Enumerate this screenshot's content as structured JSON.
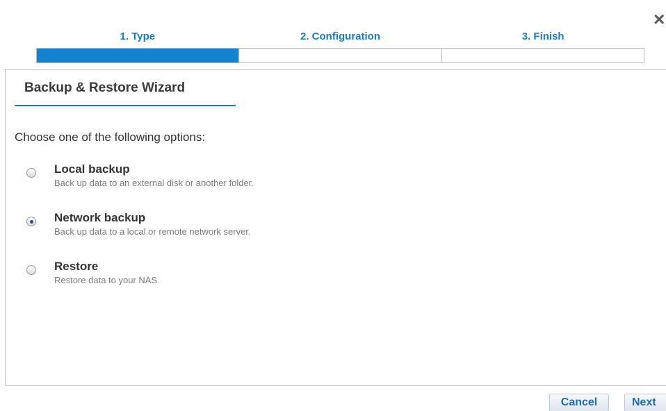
{
  "wizard": {
    "close_glyph": "×",
    "steps": [
      {
        "label": "1. Type",
        "active": true
      },
      {
        "label": "2. Configuration",
        "active": false
      },
      {
        "label": "3. Finish",
        "active": false
      }
    ],
    "title": "Backup & Restore Wizard",
    "prompt": "Choose one of the following options:",
    "options": [
      {
        "title": "Local backup",
        "description": "Back up data to an external disk or another folder.",
        "selected": false
      },
      {
        "title": "Network backup",
        "description": "Back up data to a local or remote network server.",
        "selected": true
      },
      {
        "title": "Restore",
        "description": "Restore data to your NAS.",
        "selected": false
      }
    ],
    "buttons": {
      "cancel": "Cancel",
      "next": "Next"
    }
  },
  "colors": {
    "accent": "#1582d1",
    "link_text": "#1a7cc4"
  }
}
